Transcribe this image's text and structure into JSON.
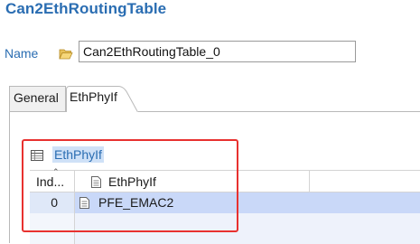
{
  "editor": {
    "title": "Can2EthRoutingTable",
    "name_label": "Name",
    "name_value": "Can2EthRoutingTable_0"
  },
  "tabs": [
    {
      "label": "General",
      "active": false
    },
    {
      "label": "EthPhyIf",
      "active": true
    }
  ],
  "section": {
    "title": "EthPhyIf"
  },
  "table": {
    "columns": [
      "Ind...",
      "EthPhyIf"
    ],
    "rows": [
      {
        "index": "0",
        "value": "PFE_EMAC2"
      }
    ]
  },
  "colors": {
    "title_blue": "#2a6db2",
    "highlight_red": "#e8312f",
    "row_selected": "#c9d8f8"
  },
  "icons": {
    "name_field": "folder-open-icon",
    "section": "table-icon",
    "column": "document-icon",
    "row": "document-icon"
  }
}
